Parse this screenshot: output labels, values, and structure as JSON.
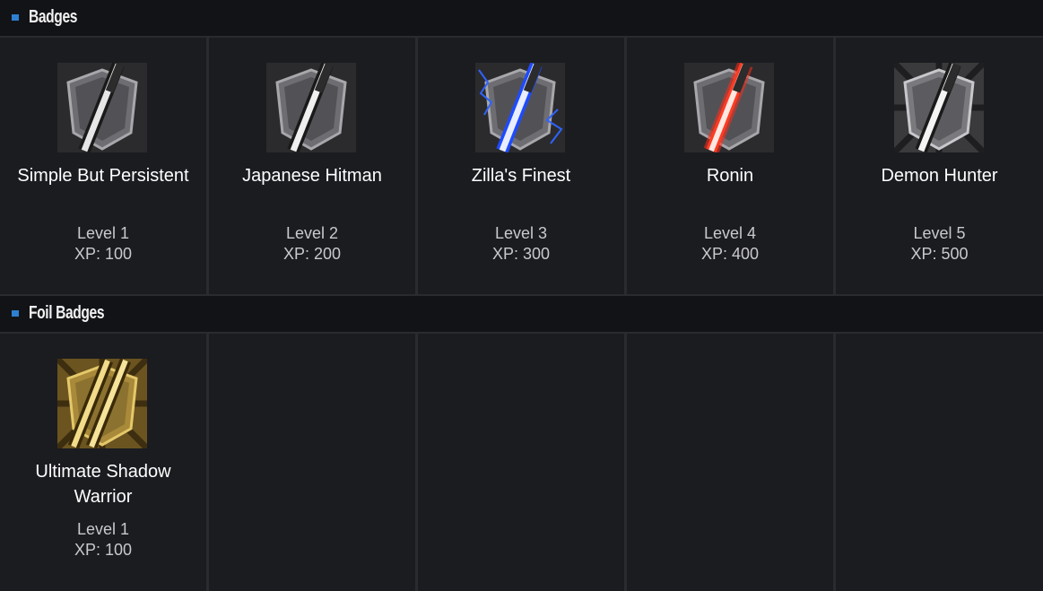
{
  "sections": [
    {
      "title": "Badges",
      "badges": [
        {
          "name": "Simple But Persistent",
          "level": "Level 1",
          "xp": "XP: 100",
          "icon": "katana-badge-icon",
          "glow": "none"
        },
        {
          "name": "Japanese Hitman",
          "level": "Level 2",
          "xp": "XP: 200",
          "icon": "katana-badge-icon",
          "glow": "none"
        },
        {
          "name": "Zilla's Finest",
          "level": "Level 3",
          "xp": "XP: 300",
          "icon": "katana-lightning-badge-icon",
          "glow": "#2f63ff"
        },
        {
          "name": "Ronin",
          "level": "Level 4",
          "xp": "XP: 400",
          "icon": "katana-red-glow-badge-icon",
          "glow": "#ff2a1a"
        },
        {
          "name": "Demon Hunter",
          "level": "Level 5",
          "xp": "XP: 500",
          "icon": "katana-rays-badge-icon",
          "glow": "none"
        }
      ]
    },
    {
      "title": "Foil Badges",
      "badges": [
        {
          "name": "Ultimate Shadow Warrior",
          "level": "Level 1",
          "xp": "XP: 100",
          "icon": "golden-katanas-badge-icon",
          "glow": "#c9a544"
        }
      ]
    }
  ],
  "colors": {
    "accent": "#2f7fd1",
    "background": "#1b1c20",
    "header_background": "#121317"
  }
}
